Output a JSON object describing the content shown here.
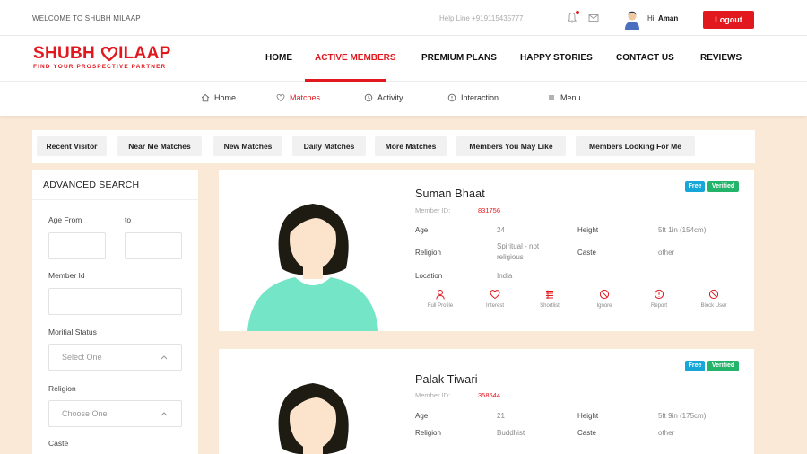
{
  "topbar": {
    "welcome": "WELCOME TO SHUBH MILAAP",
    "helpline": "Help Line +919115435777",
    "greeting_prefix": "Hi,",
    "user_name": "Aman",
    "logout_label": "Logout"
  },
  "brand": {
    "logo_left": "SHUBH",
    "logo_right": "ILAAP",
    "tagline": "FIND YOUR PROSPECTIVE PARTNER",
    "accent": "#e1181e"
  },
  "nav": {
    "items": [
      "HOME",
      "ACTIVE MEMBERS",
      "PREMIUM PLANS",
      "HAPPY STORIES",
      "CONTACT US",
      "REVIEWS"
    ],
    "active": "ACTIVE MEMBERS"
  },
  "subnav": {
    "items": [
      {
        "label": "Home",
        "icon": "home-icon"
      },
      {
        "label": "Matches",
        "icon": "match-icon"
      },
      {
        "label": "Activity",
        "icon": "activity-icon"
      },
      {
        "label": "Interaction",
        "icon": "interaction-icon"
      },
      {
        "label": "Menu",
        "icon": "menu-icon"
      }
    ],
    "active": "Matches"
  },
  "filters": [
    "Recent Visitor",
    "Near Me Matches",
    "New Matches",
    "Daily Matches",
    "More Matches",
    "Members You May Like",
    "Members Looking For Me"
  ],
  "search": {
    "title": "ADVANCED SEARCH",
    "age_from_label": "Age From",
    "age_to_label": "to",
    "member_id_label": "Member Id",
    "marital_label": "Moritial Status",
    "marital_value": "Select One",
    "religion_label": "Religion",
    "religion_value": "Choose One",
    "caste_label": "Caste"
  },
  "profiles": [
    {
      "name": "Suman Bhaat",
      "member_id_label": "Member ID:",
      "member_id": "831756",
      "badges": [
        "Free",
        "Verified"
      ],
      "age_label": "Age",
      "age": "24",
      "height_label": "Height",
      "height": "5ft 1in (154cm)",
      "religion_label": "Religion",
      "religion": "Spiritual - not religious",
      "caste_label": "Caste",
      "caste": "other",
      "location_label": "Location",
      "location": "India",
      "actions": [
        "Full Profile",
        "Interest",
        "Shortlist",
        "Ignore",
        "Report",
        "Block User"
      ]
    },
    {
      "name": "Palak Tiwari",
      "member_id_label": "Member ID:",
      "member_id": "358644",
      "badges": [
        "Free",
        "Verified"
      ],
      "age_label": "Age",
      "age": "21",
      "height_label": "Height",
      "height": "5ft 9in (175cm)",
      "religion_label": "Religion",
      "religion": "Buddhist",
      "caste_label": "Caste",
      "caste": "other"
    }
  ]
}
